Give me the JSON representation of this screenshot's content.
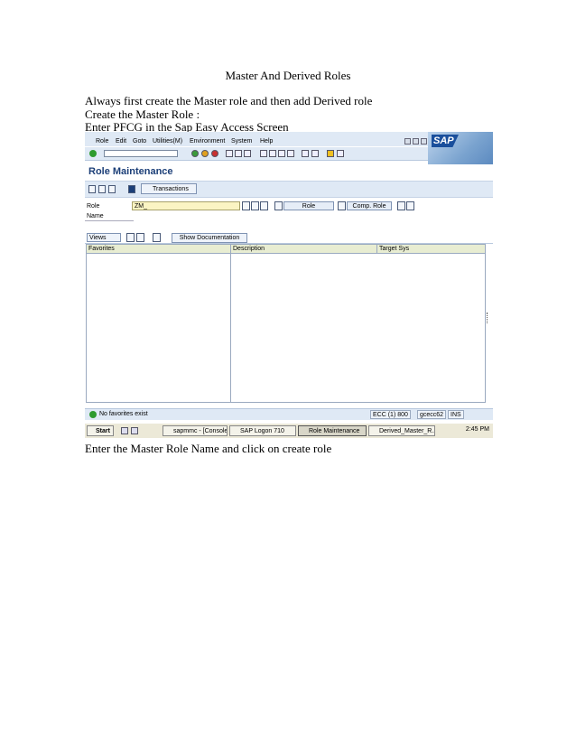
{
  "document": {
    "title": "Master And Derived Roles",
    "line1": "Always first create the Master role and then add Derived role",
    "line2": "Create the Master Role :",
    "line3": "Enter PFCG in the Sap Easy Access Screen",
    "line4": "Enter the Master Role Name and click on create role"
  },
  "sap": {
    "menu": [
      "Role",
      "Edit",
      "Goto",
      "Utilities(M)",
      "Environment",
      "System",
      "Help"
    ],
    "logo_text": "SAP",
    "screen_title": "Role Maintenance",
    "transactions_label": "Transactions",
    "role_label": "Role",
    "role_value": "ZM_",
    "name_label": "Name",
    "role_button": "Role",
    "comp_role_button": "Comp. Role",
    "views_label": "Views",
    "show_doc_button": "Show Documentation",
    "columns": [
      "Favorites",
      "Description",
      "Target Sys"
    ],
    "status_message": "No favorites exist",
    "status_system": "ECC (1) 800",
    "status_server": "gcecc62",
    "status_mode": "INS",
    "colors": {
      "title_blue": "#1c3f78",
      "field_yellow": "#fbf4c3",
      "status_green": "#2e9b2e"
    }
  },
  "taskbar": {
    "start": "Start",
    "tasks": [
      "sapmmc - [Console ...",
      "SAP Logon 710",
      "Role Maintenance",
      "Derived_Master_R..."
    ],
    "clock": "2:45 PM"
  }
}
